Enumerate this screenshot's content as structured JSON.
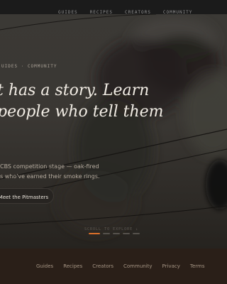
{
  "top_nav": {
    "links": [
      "GUIDES",
      "RECIPES",
      "CREATORS",
      "COMMUNITY"
    ]
  },
  "hero": {
    "breadcrumbs": [
      "UIDES",
      "·",
      "COMMUNITY"
    ],
    "headline_lines": [
      "t has a story. Learn",
      "people who tell them"
    ],
    "subcopy_lines": [
      "CBS competition stage — oak-fired",
      "s who've earned their smoke rings."
    ],
    "cta_label": "Meet the Pitmasters",
    "scroll_hint": "SCROLL TO EXPLORE ↓",
    "slides": {
      "count": 5,
      "active_index": 0
    }
  },
  "footer": {
    "links": [
      "Guides",
      "Recipes",
      "Creators",
      "Community",
      "Privacy",
      "Terms"
    ]
  },
  "colors": {
    "nav_bg": "#1b1b1b",
    "hero_sky": "#3a3733",
    "accent": "#d96f2a",
    "footer_bg": "#2a1f18"
  }
}
